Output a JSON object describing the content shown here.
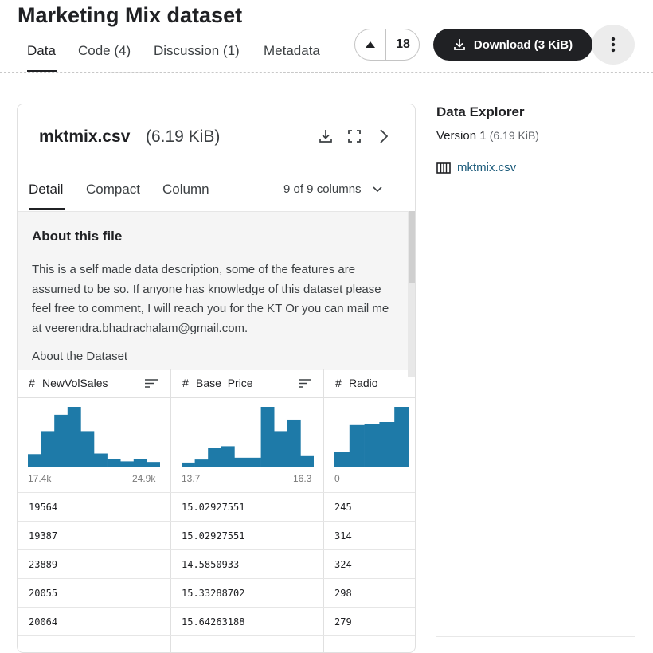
{
  "header": {
    "title": "Marketing Mix dataset",
    "tabs": [
      {
        "label": "Data",
        "active": true
      },
      {
        "label": "Code (4)",
        "active": false
      },
      {
        "label": "Discussion (1)",
        "active": false
      },
      {
        "label": "Metadata",
        "active": false
      }
    ],
    "vote_count": "18",
    "download_label": "Download (3 KiB)"
  },
  "file": {
    "name": "mktmix.csv",
    "size": "(6.19 KiB)",
    "subtabs": [
      {
        "label": "Detail",
        "active": true
      },
      {
        "label": "Compact",
        "active": false
      },
      {
        "label": "Column",
        "active": false
      }
    ],
    "column_count": "9 of 9 columns",
    "about": {
      "title": "About this file",
      "text": "This is a self made data description, some of the features are assumed to be so. If anyone has knowledge of this dataset please feel free to comment, I will reach you for the KT Or you can mail me at veerendra.bhadrachalam@gmail.com.",
      "subheading": "About the Dataset"
    }
  },
  "table": {
    "columns": [
      {
        "name": "NewVolSales",
        "type": "#",
        "range_min": "17.4k",
        "range_max": "24.9k"
      },
      {
        "name": "Base_Price",
        "type": "#",
        "range_min": "13.7",
        "range_max": "16.3"
      },
      {
        "name": "Radio",
        "type": "#",
        "range_min": "0",
        "range_max": ""
      }
    ],
    "rows": [
      [
        "19564",
        "15.02927551",
        "245"
      ],
      [
        "19387",
        "15.02927551",
        "314"
      ],
      [
        "23889",
        "14.5850933",
        "324"
      ],
      [
        "20055",
        "15.33288702",
        "298"
      ],
      [
        "20064",
        "15.64263188",
        "279"
      ]
    ]
  },
  "histograms": {
    "color": "#1e7aa8",
    "NewVolSales": [
      0.22,
      0.6,
      0.87,
      1.0,
      0.6,
      0.23,
      0.14,
      0.1,
      0.14,
      0.09
    ],
    "Base_Price": [
      0.08,
      0.13,
      0.32,
      0.35,
      0.16,
      0.16,
      1.0,
      0.6,
      0.79,
      0.2
    ],
    "Radio": [
      0.25,
      0.7,
      0.72,
      0.75,
      1.0
    ]
  },
  "explorer": {
    "title": "Data Explorer",
    "version_label": "Version 1",
    "version_size": "(6.19 KiB)",
    "file_name": "mktmix.csv"
  },
  "icons": {
    "vote": "arrow-up-icon",
    "download": "download-icon",
    "more": "more-vert-icon",
    "file_download": "download-icon",
    "expand": "fullscreen-icon",
    "next": "chevron-right-icon",
    "dropdown": "chevron-down-icon",
    "sort": "sort-icon",
    "table": "table-icon"
  }
}
